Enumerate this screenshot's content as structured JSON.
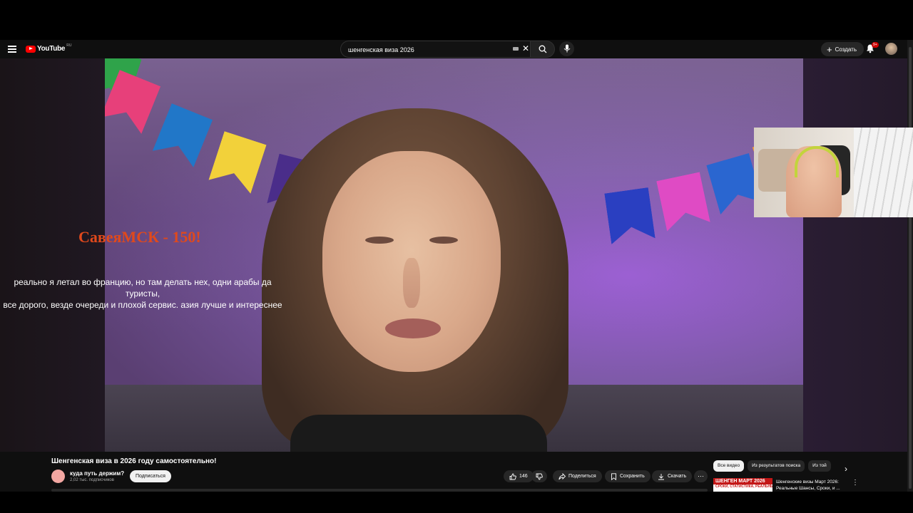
{
  "header": {
    "logo_text": "YouTube",
    "region": "RU",
    "search_value": "шенгенская виза 2026",
    "create_label": "Создать",
    "notification_badge": "9+"
  },
  "video": {
    "donation_text": "СавеяМСК - 150!",
    "chat_line1": "реально я летал во францию, но там делать нех, одни арабы да туристы,",
    "chat_line2": "все дорого, везде очереди и плохой сервис. азия лучше и интереснее"
  },
  "info": {
    "title": "Шенгенская виза в 2026 году самостоятельно!",
    "channel_name": "куда путь держим?",
    "subscribers": "2,02 тыс. подписчиков",
    "subscribe_label": "Подписаться",
    "likes": "146",
    "share_label": "Поделиться",
    "save_label": "Сохранить",
    "download_label": "Скачать"
  },
  "chips": [
    "Все видео",
    "Из результатов поиска",
    "Из той"
  ],
  "recommendation": {
    "thumb_line1": "ШЕНГЕН МАРТ 2026",
    "thumb_line2": "СРОКИ, СТАТИСТИКА, РЕАЛЬНЫЕ ШАНСЫ",
    "title": "Шенгенские визы Март 2026: Реальные Шансы, Сроки, и ..."
  }
}
